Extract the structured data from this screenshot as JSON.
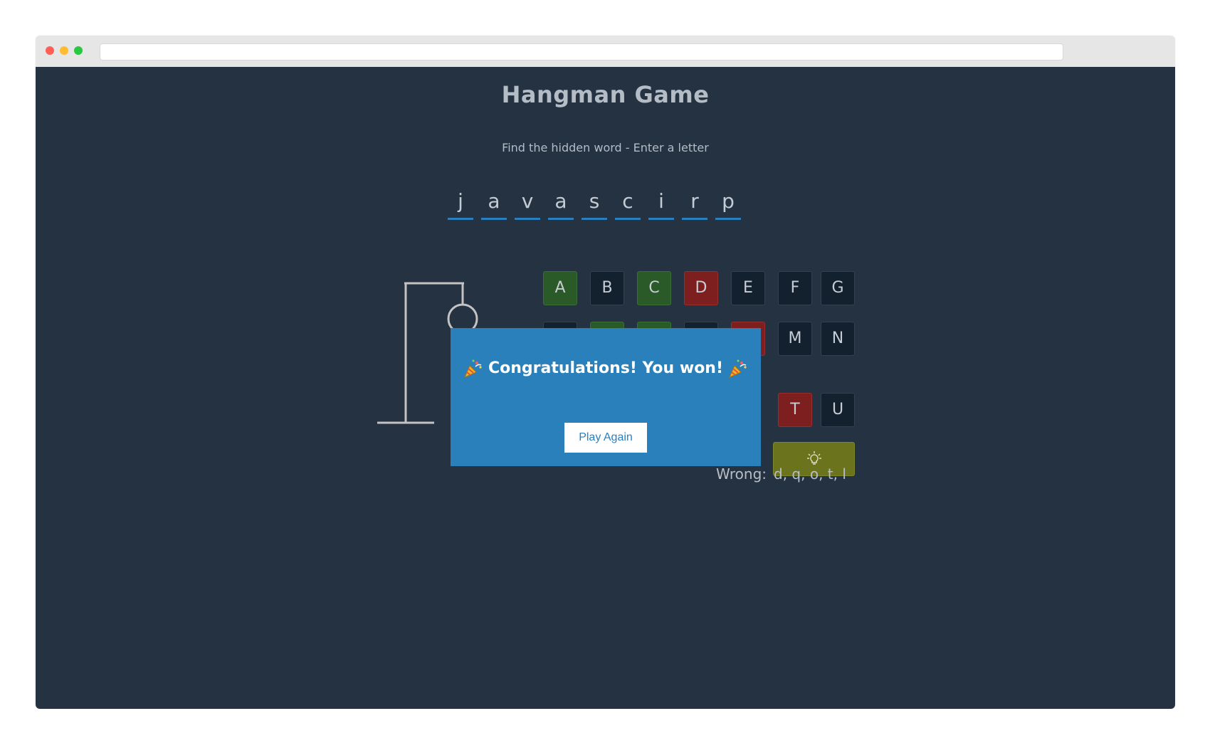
{
  "game": {
    "title": "Hangman Game",
    "subtitle": "Find the hidden word - Enter a letter",
    "word_letters": [
      "j",
      "a",
      "v",
      "a",
      "s",
      "c",
      "i",
      "r",
      "p"
    ],
    "wrong_label": "Wrong:",
    "wrong_letters": "d, q, o, t, l"
  },
  "keyboard": {
    "keys": [
      {
        "letter": "A",
        "state": "correct"
      },
      {
        "letter": "B",
        "state": "unused"
      },
      {
        "letter": "C",
        "state": "correct"
      },
      {
        "letter": "D",
        "state": "wrong"
      },
      {
        "letter": "E",
        "state": "unused"
      },
      {
        "letter": "F",
        "state": "unused"
      },
      {
        "letter": "G",
        "state": "unused"
      },
      {
        "letter": "M",
        "state": "unused"
      },
      {
        "letter": "N",
        "state": "unused"
      },
      {
        "letter": "T",
        "state": "wrong"
      },
      {
        "letter": "U",
        "state": "unused"
      }
    ],
    "hint_icon": "lightbulb-icon"
  },
  "modal": {
    "message": "Congratulations! You won!",
    "icon": "party-popper-icon",
    "button_label": "Play Again"
  },
  "colors": {
    "background": "#243242",
    "correct": "#2a5a28",
    "wrong": "#7e1f1f",
    "hint": "#6b731c",
    "modal": "#2980ba",
    "underline": "#2a7fbf"
  }
}
